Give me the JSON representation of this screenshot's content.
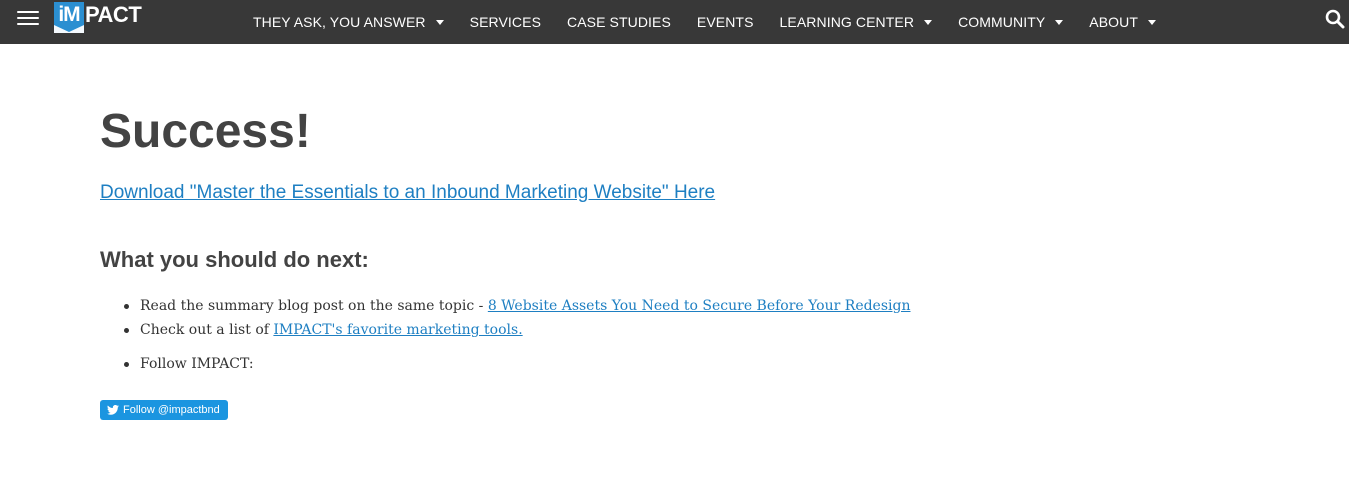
{
  "nav": {
    "logo_box": "iM",
    "logo_rest": "PACT",
    "items": [
      {
        "label": "THEY ASK, YOU ANSWER",
        "dropdown": true
      },
      {
        "label": "SERVICES",
        "dropdown": false
      },
      {
        "label": "CASE STUDIES",
        "dropdown": false
      },
      {
        "label": "EVENTS",
        "dropdown": false
      },
      {
        "label": "LEARNING CENTER",
        "dropdown": true
      },
      {
        "label": "COMMUNITY",
        "dropdown": true
      },
      {
        "label": "ABOUT",
        "dropdown": true
      }
    ],
    "icons": {
      "menu": "hamburger-menu-icon",
      "search": "search-icon",
      "caret": "caret-down-icon"
    }
  },
  "main": {
    "title": "Success!",
    "download_link": "Download \"Master the Essentials to an Inbound Marketing Website\" Here",
    "next_heading": "What you should do next:",
    "list": [
      {
        "text": "Read the summary blog post on the same topic - ",
        "link": "8 Website Assets You Need to Secure Before Your Redesign"
      },
      {
        "text": "Check out a list of ",
        "link": "IMPACT's favorite marketing tools."
      },
      {
        "text": "Follow IMPACT:",
        "link": ""
      }
    ],
    "twitter_button": "Follow @impactbnd"
  },
  "colors": {
    "nav_bg": "#383838",
    "brand_blue": "#2b8fd1",
    "link_blue": "#1e7fc2",
    "heading": "#434343",
    "twitter_blue": "#1b95e0"
  }
}
